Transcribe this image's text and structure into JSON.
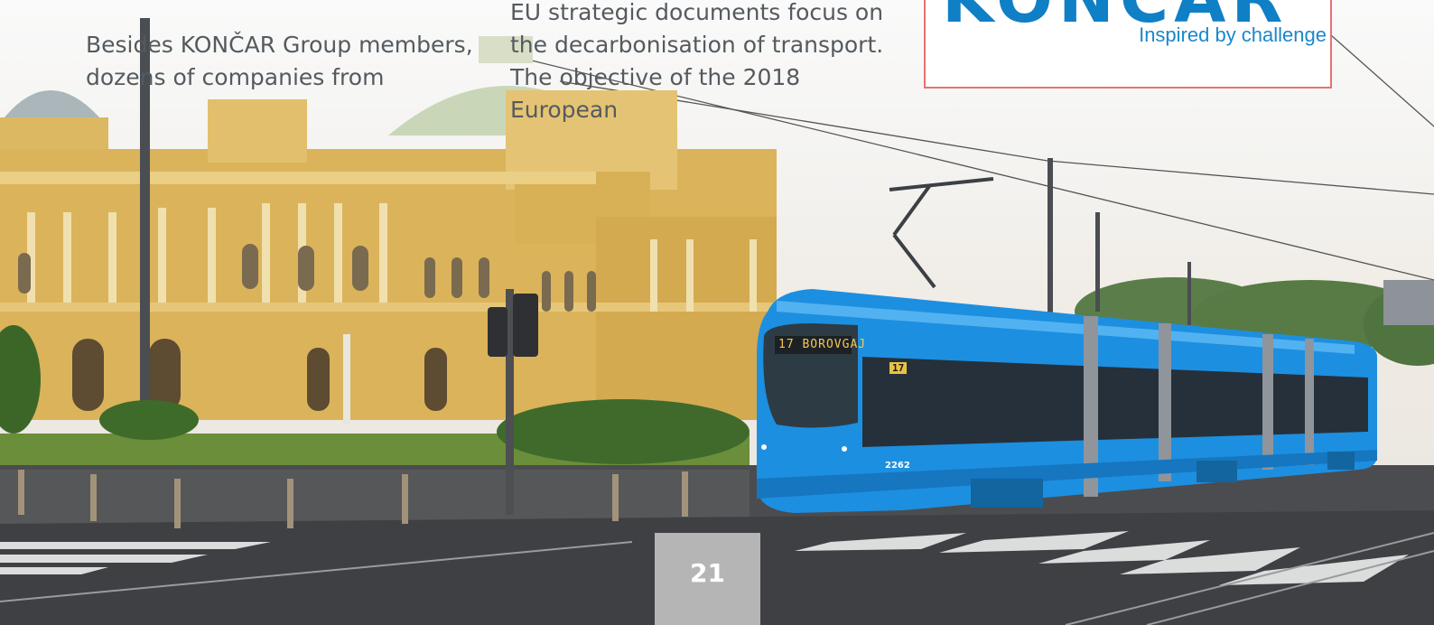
{
  "text_columns": {
    "left": "Besides KONČAR Group members,\ndozens of companies from",
    "right": "EU strategic documents focus on\nthe decarbonisation of transport.\nThe objective of the 2018 European"
  },
  "logo": {
    "wordmark": "KONČAR",
    "tagline": "Inspired by challenge"
  },
  "tram": {
    "destination_display": "17 BOROVGAJ",
    "route_number": "17",
    "fleet_number": "2262"
  },
  "page": {
    "number": "21"
  },
  "colors": {
    "logo_blue": "#0f7fc6",
    "logo_border": "#e7726f",
    "tram_blue": "#1d8fe0",
    "text": "#555a5f",
    "page_tab": "#b5b5b5"
  }
}
